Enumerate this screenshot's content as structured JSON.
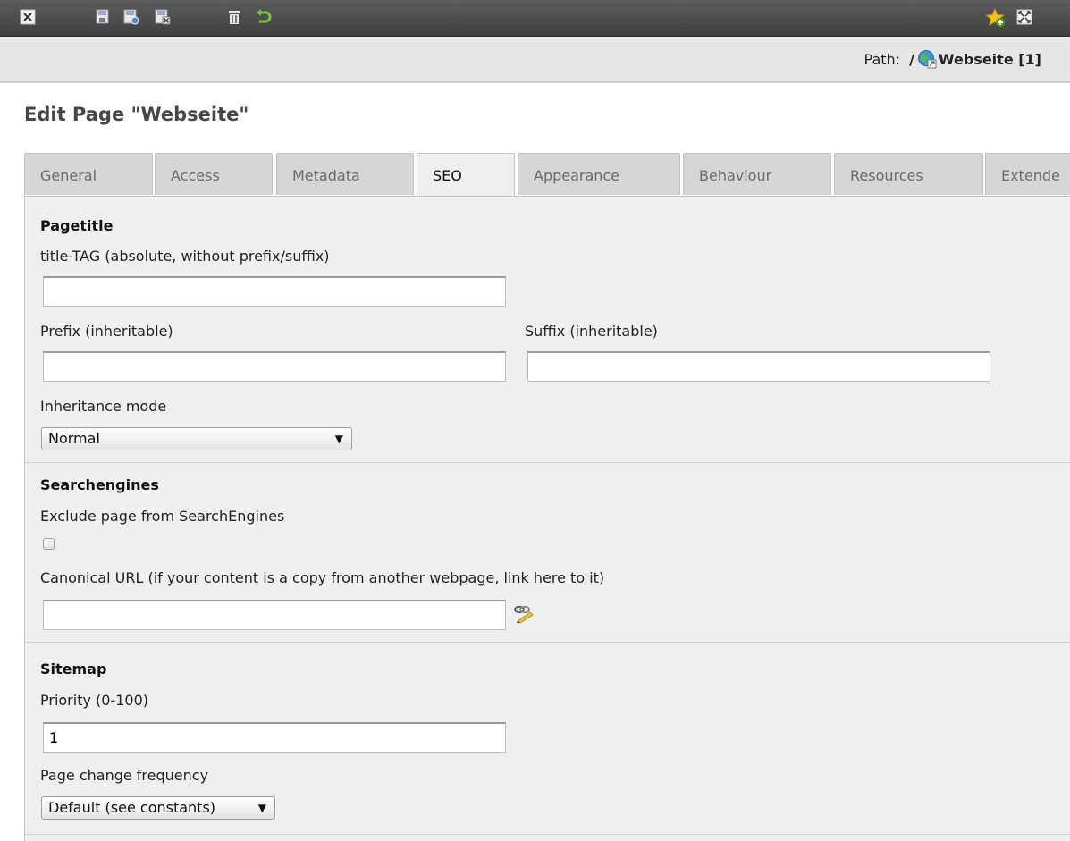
{
  "path": {
    "label": "Path:",
    "separator": "/",
    "site": "Webseite [1]"
  },
  "page_title": "Edit Page \"Webseite\"",
  "tabs": [
    {
      "label": "General"
    },
    {
      "label": "Access"
    },
    {
      "label": "Metadata"
    },
    {
      "label": "SEO",
      "active": true
    },
    {
      "label": "Appearance"
    },
    {
      "label": "Behaviour"
    },
    {
      "label": "Resources"
    },
    {
      "label": "Extende"
    }
  ],
  "sections": {
    "pagetitle": {
      "heading": "Pagetitle",
      "title_tag_label": "title-TAG (absolute, without prefix/suffix)",
      "title_tag_value": "",
      "prefix_label": "Prefix (inheritable)",
      "prefix_value": "",
      "suffix_label": "Suffix (inheritable)",
      "suffix_value": "",
      "inheritance_label": "Inheritance mode",
      "inheritance_value": "Normal"
    },
    "searchengines": {
      "heading": "Searchengines",
      "exclude_label": "Exclude page from SearchEngines",
      "exclude_checked": false,
      "canonical_label": "Canonical URL (if your content is a copy from another webpage, link here to it)",
      "canonical_value": ""
    },
    "sitemap": {
      "heading": "Sitemap",
      "priority_label": "Priority (0-100)",
      "priority_value": "1",
      "frequency_label": "Page change frequency",
      "frequency_value": "Default (see constants)"
    }
  },
  "colors": {
    "toolbar": "#4a4a4a",
    "pathbar": "#e6e6e6",
    "panel": "#efefef",
    "tab": "#d6d6d6",
    "title": "#464646"
  },
  "icons": [
    "close-icon",
    "save-icon",
    "save-view-icon",
    "save-close-icon",
    "delete-icon",
    "undo-icon",
    "bookmark-add-icon",
    "fullscreen-icon",
    "globe-page-icon",
    "link-wizard-icon"
  ]
}
